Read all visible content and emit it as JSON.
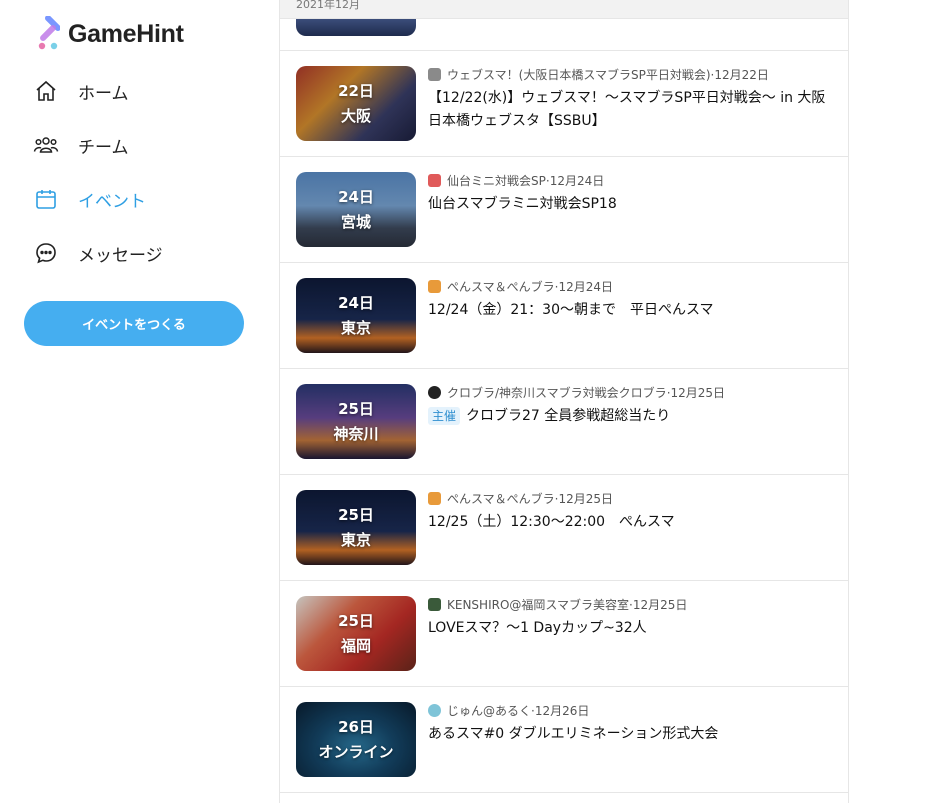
{
  "app": {
    "name": "GameHint"
  },
  "sidebar": {
    "nav": [
      {
        "label": "ホーム",
        "icon": "home-icon"
      },
      {
        "label": "チーム",
        "icon": "team-icon"
      },
      {
        "label": "イベント",
        "icon": "calendar-icon",
        "active": true
      },
      {
        "label": "メッセージ",
        "icon": "message-icon"
      }
    ],
    "create_button": "イベントをつくる"
  },
  "colors": {
    "accent": "#45aef0",
    "active": "#2f9fe3"
  },
  "feed": {
    "month_header": "2021年12月",
    "events": [
      {
        "day": "22日",
        "place": "大阪",
        "organizer": "ウェブスマ！(大阪日本橋スマブラSP平日対戦会)",
        "date": "12月22日",
        "title": "【12/22(水)】ウェブスマ！～スマブラSP平日対戦会～ in 大阪日本橋ウェブスタ【SSBU】",
        "badge": ""
      },
      {
        "day": "24日",
        "place": "宮城",
        "organizer": "仙台ミニ対戦会SP",
        "date": "12月24日",
        "title": "仙台スマブラミニ対戦会SP18",
        "badge": ""
      },
      {
        "day": "24日",
        "place": "東京",
        "organizer": "ぺんスマ＆ぺんブラ",
        "date": "12月24日",
        "title": "12/24（金）21：30～朝まで　平日ぺんスマ",
        "badge": ""
      },
      {
        "day": "25日",
        "place": "神奈川",
        "organizer": "クロブラ/神奈川スマブラ対戦会クロブラ",
        "date": "12月25日",
        "title": "クロブラ27 全員参戦超総当たり",
        "badge": "主催"
      },
      {
        "day": "25日",
        "place": "東京",
        "organizer": "ぺんスマ＆ぺんブラ",
        "date": "12月25日",
        "title": "12/25（土）12:30～22:00　ぺんスマ",
        "badge": ""
      },
      {
        "day": "25日",
        "place": "福岡",
        "organizer": "KENSHIRO@福岡スマブラ美容室",
        "date": "12月25日",
        "title": "LOVEスマ？～1 Dayカップ~32人",
        "badge": ""
      },
      {
        "day": "26日",
        "place": "オンライン",
        "organizer": "じゅん@あるく",
        "date": "12月26日",
        "title": "あるスマ#0 ダブルエリミネーション形式大会",
        "badge": ""
      }
    ]
  }
}
